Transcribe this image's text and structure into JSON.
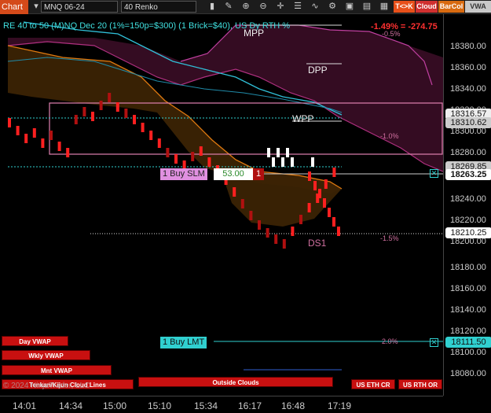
{
  "toolbar": {
    "chart_menu": "Chart",
    "instrument": "MNQ 06-24",
    "bar_type": "40 Renko",
    "buttons": {
      "tk": "T<>K",
      "cloud": "Cloud",
      "barcol": "BarCol",
      "vwap": "VWA"
    },
    "colors": {
      "tk": "#e8501a",
      "cloud": "#d03030",
      "barcol": "#d86a10",
      "vwap": "#c8c8c8"
    }
  },
  "overlay": {
    "indicator_label": "RE 40 to 50 (M)NQ Dec 20 (1%=150p=$300) (1 Brick=$40), US Dy RTH %",
    "pnl": "-1.49% = -274.75",
    "levels": {
      "mpp": "MPP",
      "dpp": "DPP",
      "wpp": "WPP",
      "ds1": "DS1"
    },
    "percent_labels": {
      "p_neg05": "-0.5%",
      "p_neg10": "-1.0%",
      "p_neg15": "-1.5%",
      "p_20": "2.0%"
    }
  },
  "orders": {
    "buy_slm": {
      "label": "1 Buy SLM",
      "price_offset": "53.00",
      "qty": "1",
      "tag": "18263.25"
    },
    "buy_lmt": {
      "label": "1 Buy LMT",
      "tag": "18111.50"
    }
  },
  "price_axis": {
    "ticks": [
      "18380.00",
      "18360.00",
      "18340.00",
      "18320.00",
      "18300.00",
      "18280.00",
      "18240.00",
      "18220.00",
      "18200.00",
      "18180.00",
      "18160.00",
      "18140.00",
      "18120.00",
      "18100.00",
      "18080.00"
    ],
    "tags": {
      "p1": "18316.57",
      "p2": "18310.62",
      "p3": "18269.85",
      "last": "18210.25"
    }
  },
  "time_axis": [
    "14:01",
    "14:34",
    "15:00",
    "15:10",
    "15:34",
    "16:17",
    "16:48",
    "17:19"
  ],
  "bottom_buttons": {
    "day_vwap": "Day VWAP",
    "wkly_vwap": "Wkly VWAP",
    "mnt_vwap": "Mnt VWAP",
    "outside_clouds": "Outside Clouds",
    "us_eth_cr": "US ETH CR",
    "us_rth_or": "US RTH OR"
  },
  "footer": {
    "copyright": "© 2024 NinjaTrader, LLC",
    "cloud_lines": "Tenkan/Kijun Cloud Lines"
  },
  "chart_data": {
    "type": "renko",
    "brick_size": 40,
    "ylim": [
      18070,
      18410
    ],
    "bricks": [
      {
        "x": 0,
        "up": false
      },
      {
        "x": 1,
        "up": false
      },
      {
        "x": 2,
        "up": false
      },
      {
        "x": 3,
        "up": false
      },
      {
        "x": 4,
        "up": false
      },
      {
        "x": 5,
        "up": true
      },
      {
        "x": 6,
        "up": false
      },
      {
        "x": 7,
        "up": false
      },
      {
        "x": 8,
        "up": true
      },
      {
        "x": 9,
        "up": true
      },
      {
        "x": 10,
        "up": false
      },
      {
        "x": 11,
        "up": true
      },
      {
        "x": 12,
        "up": true
      },
      {
        "x": 13,
        "up": false
      },
      {
        "x": 14,
        "up": true
      },
      {
        "x": 15,
        "up": false
      },
      {
        "x": 16,
        "up": false
      },
      {
        "x": 17,
        "up": false
      },
      {
        "x": 18,
        "up": false
      },
      {
        "x": 19,
        "up": true
      },
      {
        "x": 20,
        "up": false
      },
      {
        "x": 21,
        "up": false
      },
      {
        "x": 22,
        "up": true
      },
      {
        "x": 23,
        "up": false
      },
      {
        "x": 24,
        "up": false
      },
      {
        "x": 25,
        "up": false
      },
      {
        "x": 26,
        "up": false
      },
      {
        "x": 27,
        "up": false
      },
      {
        "x": 28,
        "up": true
      },
      {
        "x": 29,
        "up": true
      },
      {
        "x": 30,
        "up": true
      },
      {
        "x": 31,
        "up": true
      },
      {
        "x": 32,
        "up": true
      },
      {
        "x": 33,
        "up": true
      },
      {
        "x": 34,
        "up": false
      },
      {
        "x": 35,
        "up": true
      },
      {
        "x": 36,
        "up": false
      },
      {
        "x": 37,
        "up": false
      },
      {
        "x": 38,
        "up": false
      },
      {
        "x": 39,
        "up": false
      }
    ]
  }
}
